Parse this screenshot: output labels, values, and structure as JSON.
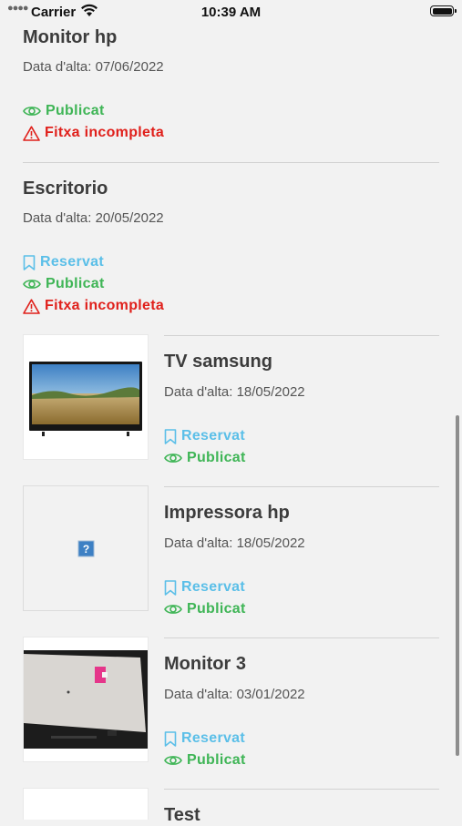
{
  "status_bar": {
    "carrier": "Carrier",
    "time": "10:39 AM"
  },
  "labels": {
    "reservat": "Reservat",
    "publicat": "Publicat",
    "incomplete": "Fitxa incompleta"
  },
  "items": [
    {
      "title": "Monitor hp",
      "date": "Data d'alta: 07/06/2022",
      "reservat": false,
      "publicat": true,
      "incomplete": true,
      "image": "none"
    },
    {
      "title": "Escritorio",
      "date": "Data d'alta: 20/05/2022",
      "reservat": true,
      "publicat": true,
      "incomplete": true,
      "image": "none"
    },
    {
      "title": "TV samsung",
      "date": "Data d'alta: 18/05/2022",
      "reservat": true,
      "publicat": true,
      "incomplete": false,
      "image": "tv-photo"
    },
    {
      "title": "Impressora hp",
      "date": "Data d'alta: 18/05/2022",
      "reservat": true,
      "publicat": true,
      "incomplete": false,
      "image": "missing-image"
    },
    {
      "title": "Monitor 3",
      "date": "Data d'alta: 03/01/2022",
      "reservat": true,
      "publicat": true,
      "incomplete": false,
      "image": "monitor-photo"
    },
    {
      "title": "Test",
      "date": "",
      "reservat": false,
      "publicat": false,
      "incomplete": false,
      "image": "blank"
    }
  ],
  "colors": {
    "reservat": "#5bbfe8",
    "publicat": "#3fb556",
    "incomplete": "#e0201b",
    "background": "#f2f2f2"
  }
}
